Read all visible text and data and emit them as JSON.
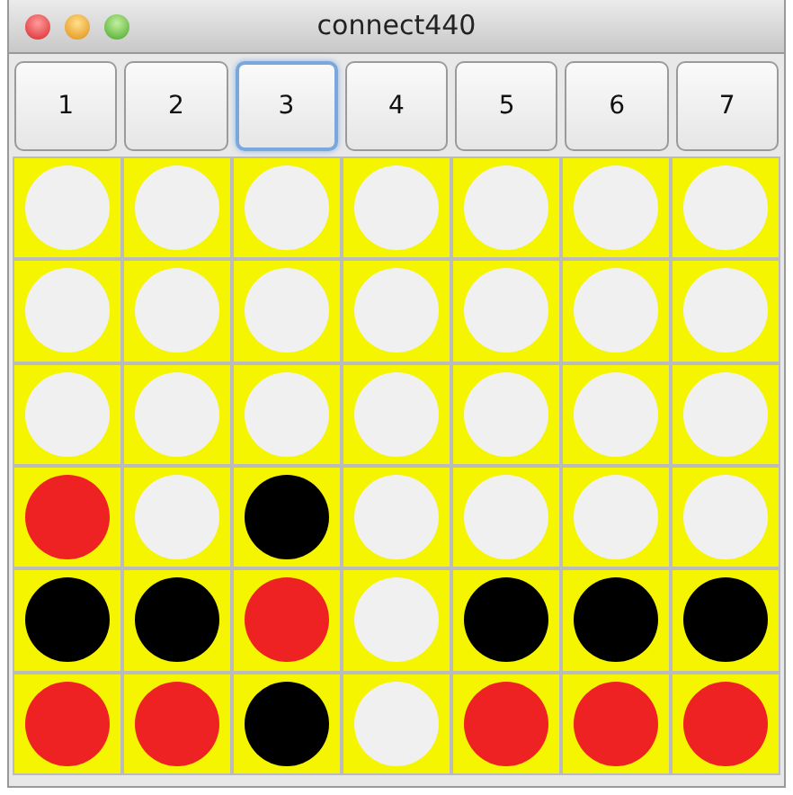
{
  "window": {
    "title": "connect440"
  },
  "column_buttons": [
    {
      "label": "1",
      "focused": false
    },
    {
      "label": "2",
      "focused": false
    },
    {
      "label": "3",
      "focused": true
    },
    {
      "label": "4",
      "focused": false
    },
    {
      "label": "5",
      "focused": false
    },
    {
      "label": "6",
      "focused": false
    },
    {
      "label": "7",
      "focused": false
    }
  ],
  "board": {
    "rows": [
      [
        {
          "kind": "empty"
        },
        {
          "kind": "empty"
        },
        {
          "kind": "empty"
        },
        {
          "kind": "empty"
        },
        {
          "kind": "empty"
        },
        {
          "kind": "empty"
        },
        {
          "kind": "empty"
        }
      ],
      [
        {
          "kind": "empty"
        },
        {
          "kind": "empty"
        },
        {
          "kind": "empty"
        },
        {
          "kind": "empty"
        },
        {
          "kind": "empty"
        },
        {
          "kind": "empty"
        },
        {
          "kind": "empty"
        }
      ],
      [
        {
          "kind": "empty"
        },
        {
          "kind": "empty"
        },
        {
          "kind": "empty"
        },
        {
          "kind": "empty"
        },
        {
          "kind": "empty"
        },
        {
          "kind": "empty"
        },
        {
          "kind": "empty"
        }
      ],
      [
        {
          "kind": "piece",
          "color": "#ee2222"
        },
        {
          "kind": "empty"
        },
        {
          "kind": "piece",
          "color": "#000000"
        },
        {
          "kind": "empty"
        },
        {
          "kind": "empty"
        },
        {
          "kind": "empty"
        },
        {
          "kind": "empty"
        }
      ],
      [
        {
          "kind": "piece",
          "color": "#000000"
        },
        {
          "kind": "piece",
          "color": "#000000"
        },
        {
          "kind": "piece",
          "color": "#ee2222"
        },
        {
          "kind": "empty"
        },
        {
          "kind": "piece",
          "color": "#000000"
        },
        {
          "kind": "piece",
          "color": "#000000"
        },
        {
          "kind": "piece",
          "color": "#000000"
        }
      ],
      [
        {
          "kind": "piece",
          "color": "#ee2222"
        },
        {
          "kind": "piece",
          "color": "#ee2222"
        },
        {
          "kind": "piece",
          "color": "#000000"
        },
        {
          "kind": "empty"
        },
        {
          "kind": "piece",
          "color": "#ee2222"
        },
        {
          "kind": "piece",
          "color": "#ee2222"
        },
        {
          "kind": "piece",
          "color": "#ee2222"
        }
      ]
    ]
  }
}
